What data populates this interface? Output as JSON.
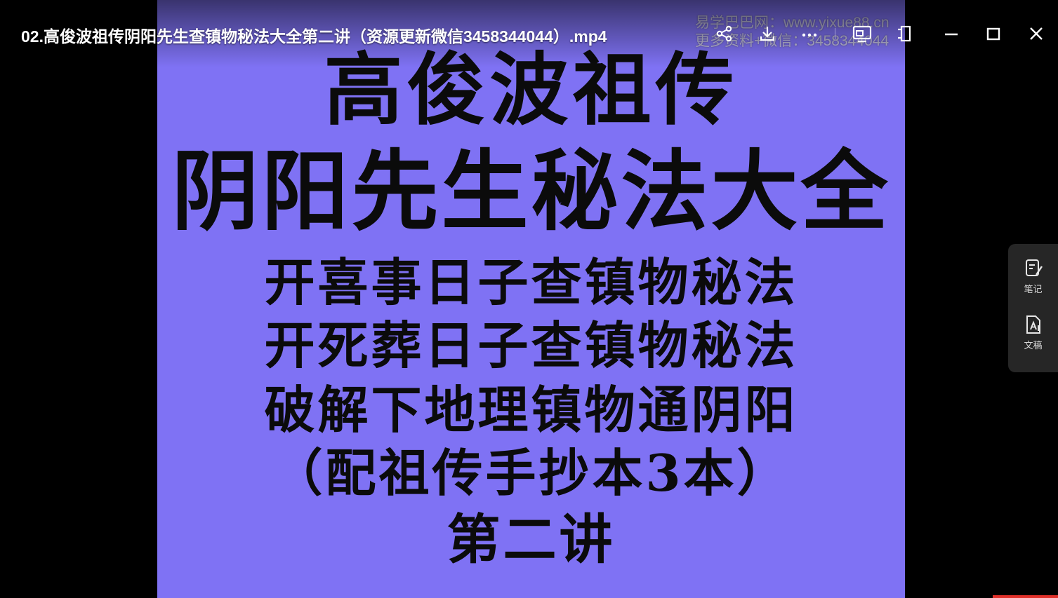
{
  "window": {
    "title": "02.高俊波祖传阴阳先生查镇物秘法大全第二讲（资源更新微信3458344044）.mp4"
  },
  "toolbar": {
    "share_icon": "share-icon",
    "download_icon": "download-icon",
    "more_icon": "more-icon",
    "cast_icon": "cast-icon",
    "pin_icon": "pin-icon",
    "minimize_icon": "minimize-icon",
    "maximize_icon": "maximize-icon",
    "close_icon": "close-icon"
  },
  "watermark": {
    "line1": "易学巴巴网：www.yixue88.cn",
    "line2": "更多资料+微信：3458344044"
  },
  "slide": {
    "line1": "高俊波祖传",
    "line2": "阴阳先生秘法大全",
    "line3": "开喜事日子查镇物秘法",
    "line4": "开死葬日子查镇物秘法",
    "line5": "破解下地理镇物通阴阳",
    "line6": "（配祖传手抄本3本）",
    "line7": "第二讲"
  },
  "side_panel": {
    "notes_label": "笔记",
    "transcript_label": "文稿"
  },
  "colors": {
    "slide_background": "#7f72f4",
    "panel_background": "#262626",
    "accent": "#e0302a"
  }
}
